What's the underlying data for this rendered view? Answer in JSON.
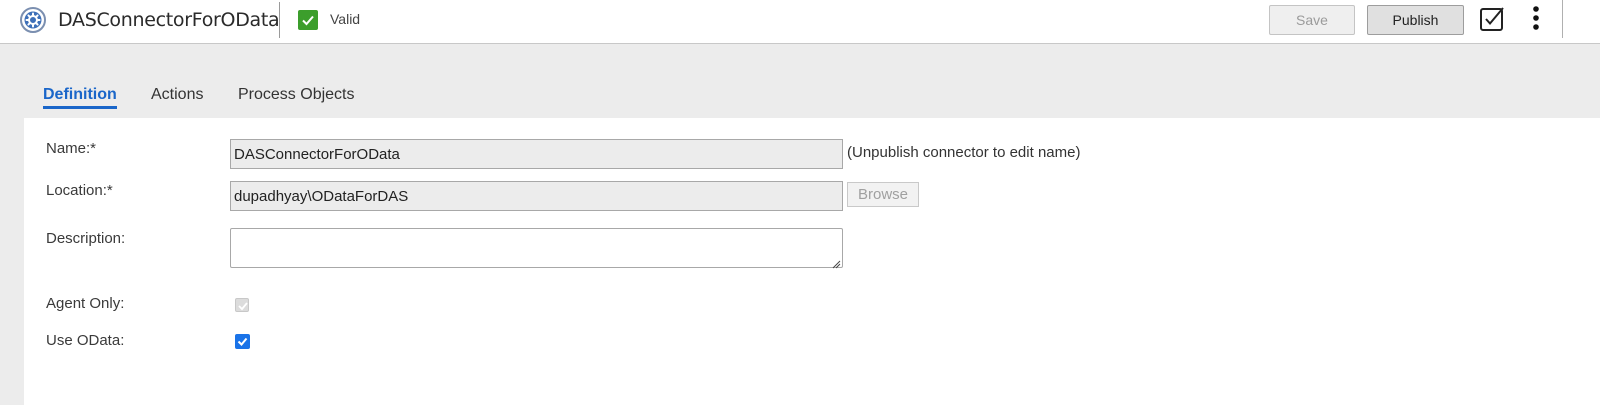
{
  "header": {
    "app_icon": "gear-badge-icon",
    "title": "DASConnectorForOData",
    "status_icon": "check-icon",
    "status_label": "Valid",
    "save_label": "Save",
    "publish_label": "Publish",
    "validate_icon": "validate-icon",
    "more_icon": "more-options-icon"
  },
  "tabs": [
    {
      "label": "Definition",
      "active": true
    },
    {
      "label": "Actions",
      "active": false
    },
    {
      "label": "Process Objects",
      "active": false
    }
  ],
  "form": {
    "name": {
      "label": "Name:*",
      "value": "DASConnectorForOData",
      "hint": "(Unpublish connector to edit name)"
    },
    "location": {
      "label": "Location:*",
      "value": "dupadhyay\\ODataForDAS",
      "browse_label": "Browse"
    },
    "description": {
      "label": "Description:",
      "value": ""
    },
    "agent_only": {
      "label": "Agent Only:",
      "checked": true,
      "disabled": true
    },
    "use_odata": {
      "label": "Use OData:",
      "checked": true,
      "disabled": false
    }
  },
  "colors": {
    "accent": "#1a66c9",
    "valid_green": "#3c9e2c",
    "checkbox_blue": "#1a73e8"
  }
}
